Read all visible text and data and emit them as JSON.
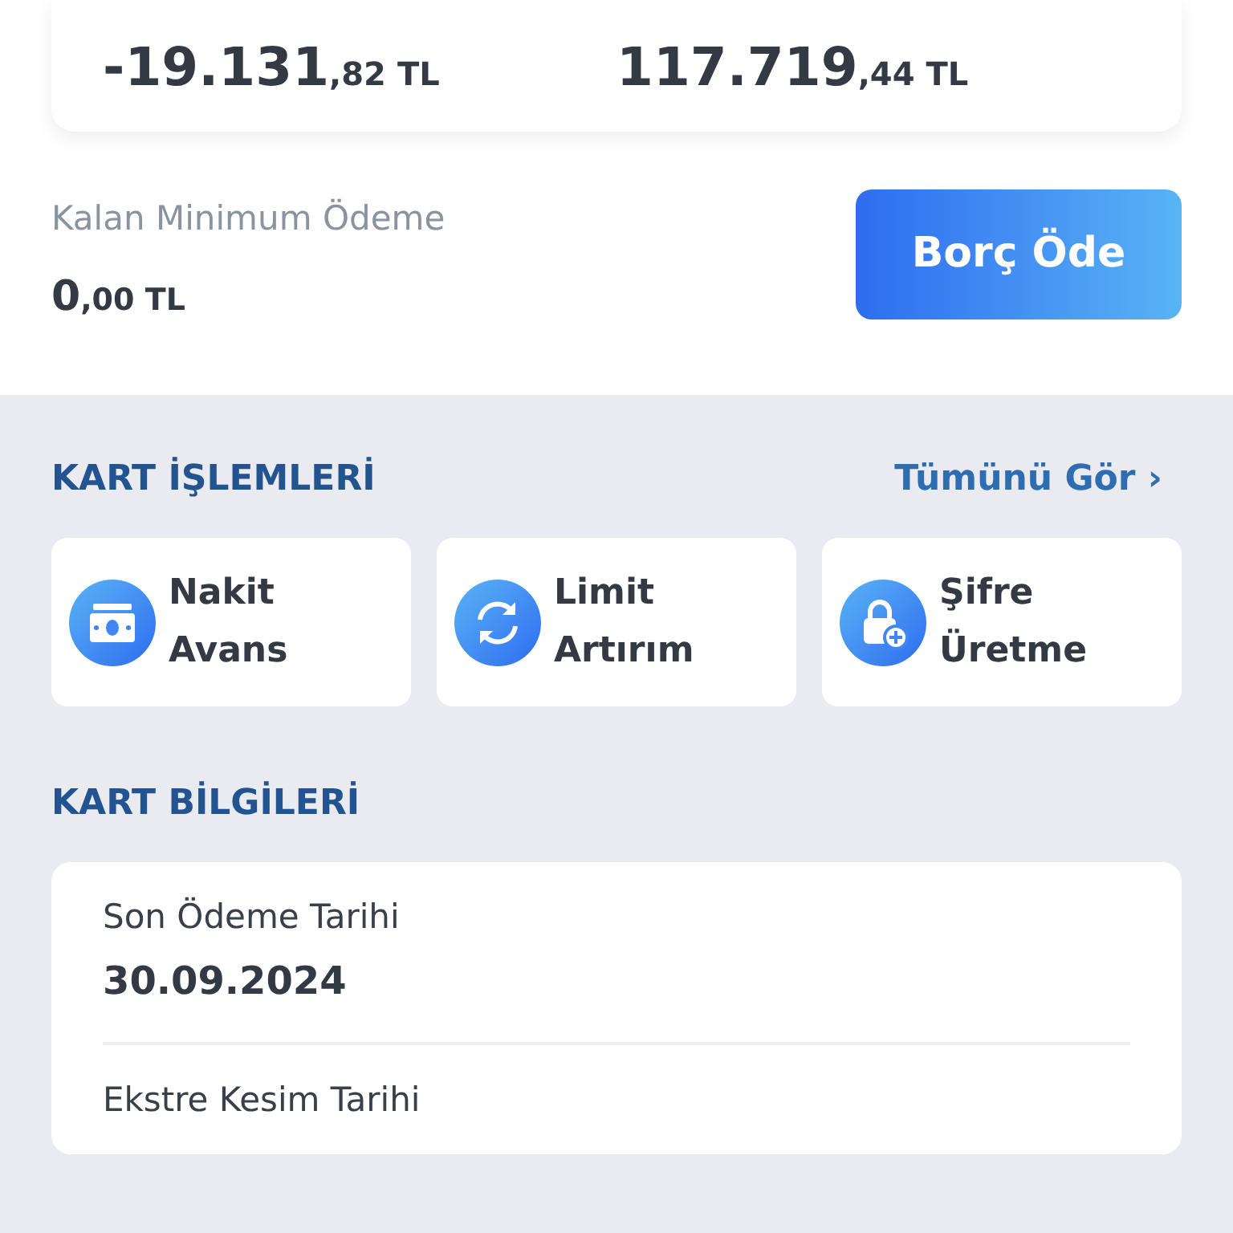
{
  "balances": [
    {
      "main": "-19.131",
      "fraction": ",82 TL"
    },
    {
      "main": "117.719",
      "fraction": ",44 TL"
    }
  ],
  "minimum_payment": {
    "label": "Kalan Minimum Ödeme",
    "main": "0",
    "fraction": ",00 TL"
  },
  "pay_button": "Borç Öde",
  "card_operations": {
    "title": "KART İŞLEMLERİ",
    "see_all": "Tümünü Gör",
    "see_all_chevron": "›",
    "items": [
      {
        "kind": "cash",
        "label": "Nakit Avans"
      },
      {
        "kind": "refresh",
        "label": "Limit Artırım"
      },
      {
        "kind": "lock",
        "label": "Şifre Üretme"
      }
    ]
  },
  "card_info": {
    "title": "KART BİLGİLERİ",
    "fields": [
      {
        "label": "Son Ödeme Tarihi",
        "value": "30.09.2024"
      },
      {
        "label": "Ekstre Kesim Tarihi"
      }
    ]
  }
}
